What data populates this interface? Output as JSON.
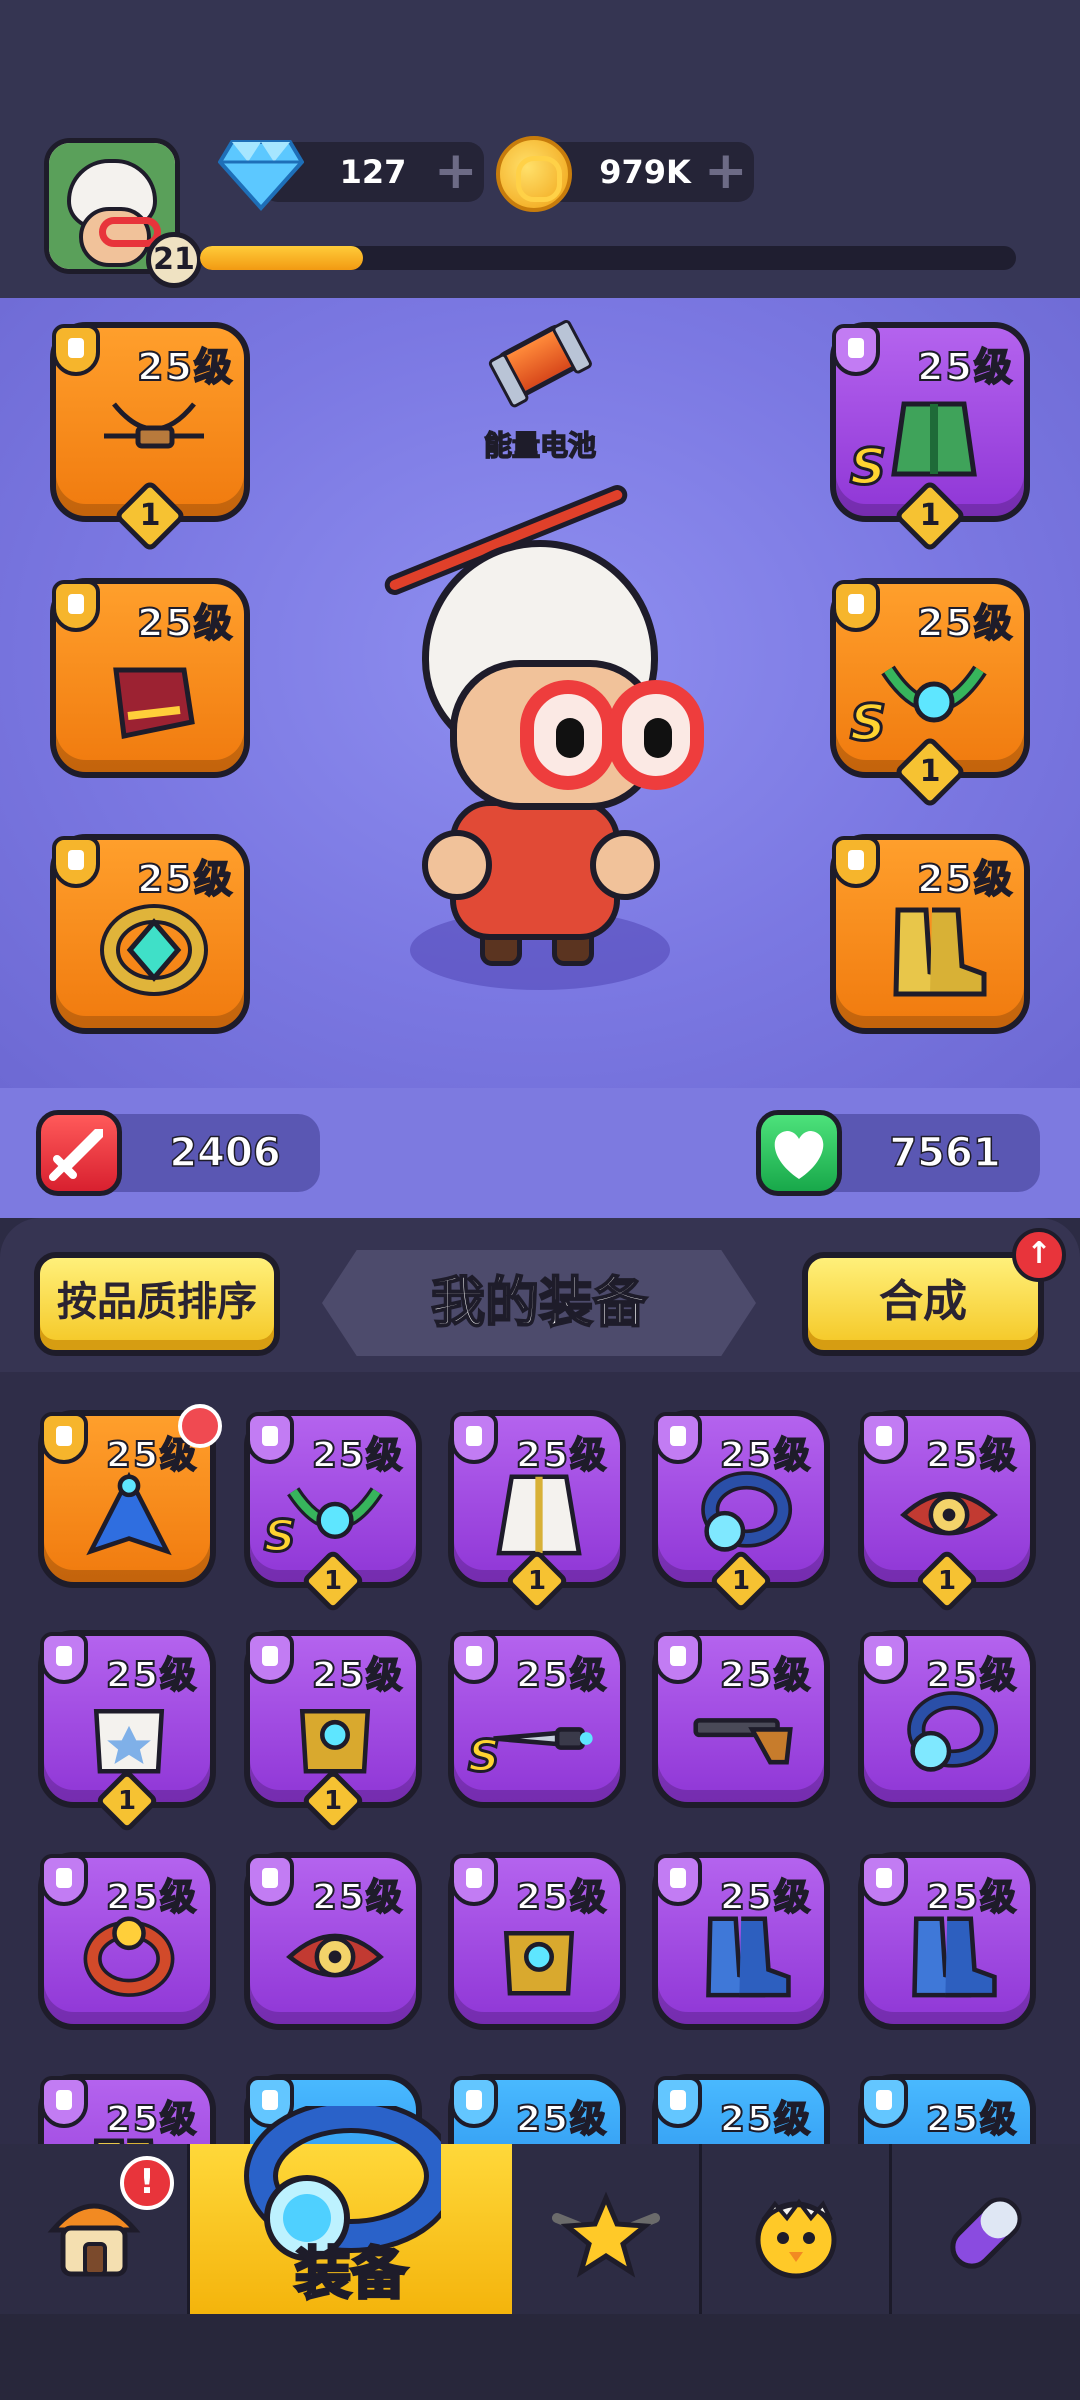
{
  "player": {
    "level": "21",
    "xp_fraction": 0.2
  },
  "currency": {
    "gems": "127",
    "coins": "979K"
  },
  "hero": {
    "energy_label": "能量电池"
  },
  "stats": {
    "attack": "2406",
    "hp": "7561"
  },
  "equipped": {
    "left": [
      {
        "level": "25级",
        "stars": "1",
        "rarity": "orange",
        "item": "crossbow"
      },
      {
        "level": "25级",
        "stars": "",
        "rarity": "orange",
        "item": "gauntlet"
      },
      {
        "level": "25级",
        "stars": "",
        "rarity": "orange",
        "item": "ring"
      }
    ],
    "right": [
      {
        "level": "25级",
        "stars": "1",
        "rarity": "purple",
        "rank": "S",
        "item": "armor"
      },
      {
        "level": "25级",
        "stars": "1",
        "rarity": "orange",
        "rank": "S",
        "item": "necklace"
      },
      {
        "level": "25级",
        "stars": "",
        "rarity": "orange",
        "item": "boots"
      }
    ]
  },
  "panel": {
    "sort_button": "按品质排序",
    "title": "我的装备",
    "merge_button": "合成",
    "merge_alert": "↑"
  },
  "inventory": [
    {
      "level": "25级",
      "stars": "",
      "rarity": "orange",
      "item": "cape"
    },
    {
      "level": "25级",
      "stars": "1",
      "rarity": "purple",
      "rank": "S",
      "item": "necklace"
    },
    {
      "level": "25级",
      "stars": "1",
      "rarity": "purple",
      "item": "robe"
    },
    {
      "level": "25级",
      "stars": "1",
      "rarity": "purple",
      "item": "orb-ring"
    },
    {
      "level": "25级",
      "stars": "1",
      "rarity": "purple",
      "item": "eye-amulet"
    },
    {
      "level": "25级",
      "stars": "1",
      "rarity": "purple",
      "item": "glove-white"
    },
    {
      "level": "25级",
      "stars": "1",
      "rarity": "purple",
      "item": "glove-gold"
    },
    {
      "level": "25级",
      "stars": "",
      "rarity": "purple",
      "rank": "S",
      "item": "dagger"
    },
    {
      "level": "25级",
      "stars": "",
      "rarity": "purple",
      "item": "shotgun"
    },
    {
      "level": "25级",
      "stars": "",
      "rarity": "purple",
      "item": "orb-ring"
    },
    {
      "level": "25级",
      "stars": "",
      "rarity": "purple",
      "item": "red-ring"
    },
    {
      "level": "25级",
      "stars": "",
      "rarity": "purple",
      "item": "eye-amulet"
    },
    {
      "level": "25级",
      "stars": "",
      "rarity": "purple",
      "item": "glove-gold"
    },
    {
      "level": "25级",
      "stars": "",
      "rarity": "purple",
      "item": "boots-blue"
    },
    {
      "level": "25级",
      "stars": "",
      "rarity": "purple",
      "item": "boots-blue"
    },
    {
      "level": "25级",
      "stars": "",
      "rarity": "purple",
      "item": "boots"
    },
    {
      "level": "",
      "stars": "",
      "rarity": "blue",
      "item": "weapon"
    },
    {
      "level": "25级",
      "stars": "",
      "rarity": "blue",
      "item": "weapon"
    },
    {
      "level": "25级",
      "stars": "",
      "rarity": "blue",
      "item": "weapon"
    },
    {
      "level": "25级",
      "stars": "",
      "rarity": "blue",
      "item": "weapon"
    }
  ],
  "nav": {
    "home_alert": "!",
    "equipment_label": "装备"
  },
  "colors": {
    "orange": "#f58a1c",
    "purple": "#a24ce4",
    "blue": "#2f9cf3",
    "gold": "#f6c232"
  }
}
